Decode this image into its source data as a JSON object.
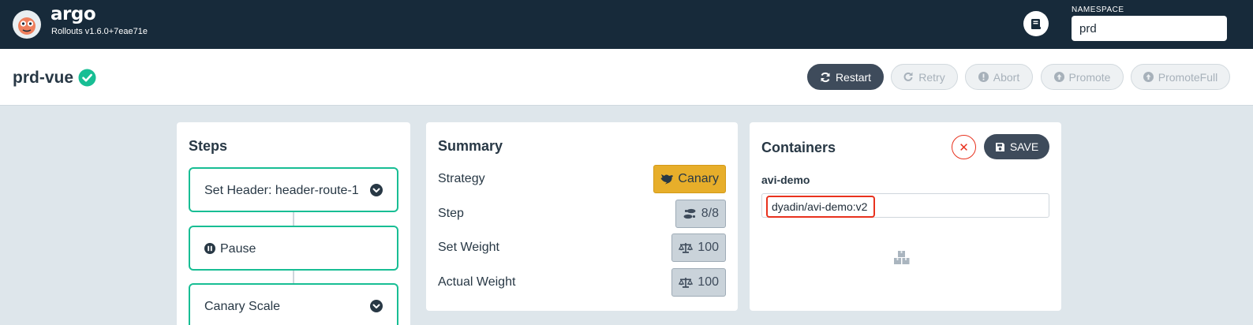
{
  "app": {
    "brand": "argo",
    "version": "Rollouts v1.6.0+7eae71e"
  },
  "namespace": {
    "label": "NAMESPACE",
    "value": "prd"
  },
  "rollout": {
    "name": "prd-vue",
    "status": "healthy"
  },
  "actions": {
    "restart": "Restart",
    "retry": "Retry",
    "abort": "Abort",
    "promote": "Promote",
    "promote_full": "PromoteFull"
  },
  "steps": {
    "title": "Steps",
    "items": [
      {
        "label": "Set Header: header-route-1",
        "expandable": true
      },
      {
        "label": "Pause",
        "expandable": false
      },
      {
        "label": "Canary Scale",
        "expandable": true
      }
    ]
  },
  "summary": {
    "title": "Summary",
    "rows": [
      {
        "key": "Strategy",
        "value": "Canary",
        "icon": "dove-icon"
      },
      {
        "key": "Step",
        "value": "8/8",
        "icon": "shoe-prints-icon"
      },
      {
        "key": "Set Weight",
        "value": "100",
        "icon": "balance-scale-icon"
      },
      {
        "key": "Actual Weight",
        "value": "100",
        "icon": "balance-scale-icon"
      }
    ]
  },
  "containers": {
    "title": "Containers",
    "save_label": "SAVE",
    "cancel_icon": "close-icon",
    "items": [
      {
        "name": "avi-demo",
        "image": "dyadin/avi-demo:v2"
      }
    ]
  },
  "colors": {
    "topbar": "#172a3a",
    "accent_green": "#18be94",
    "canary_yellow": "#e7ae2a",
    "dark_button": "#3e4b5b",
    "error_red": "#e8321e"
  }
}
